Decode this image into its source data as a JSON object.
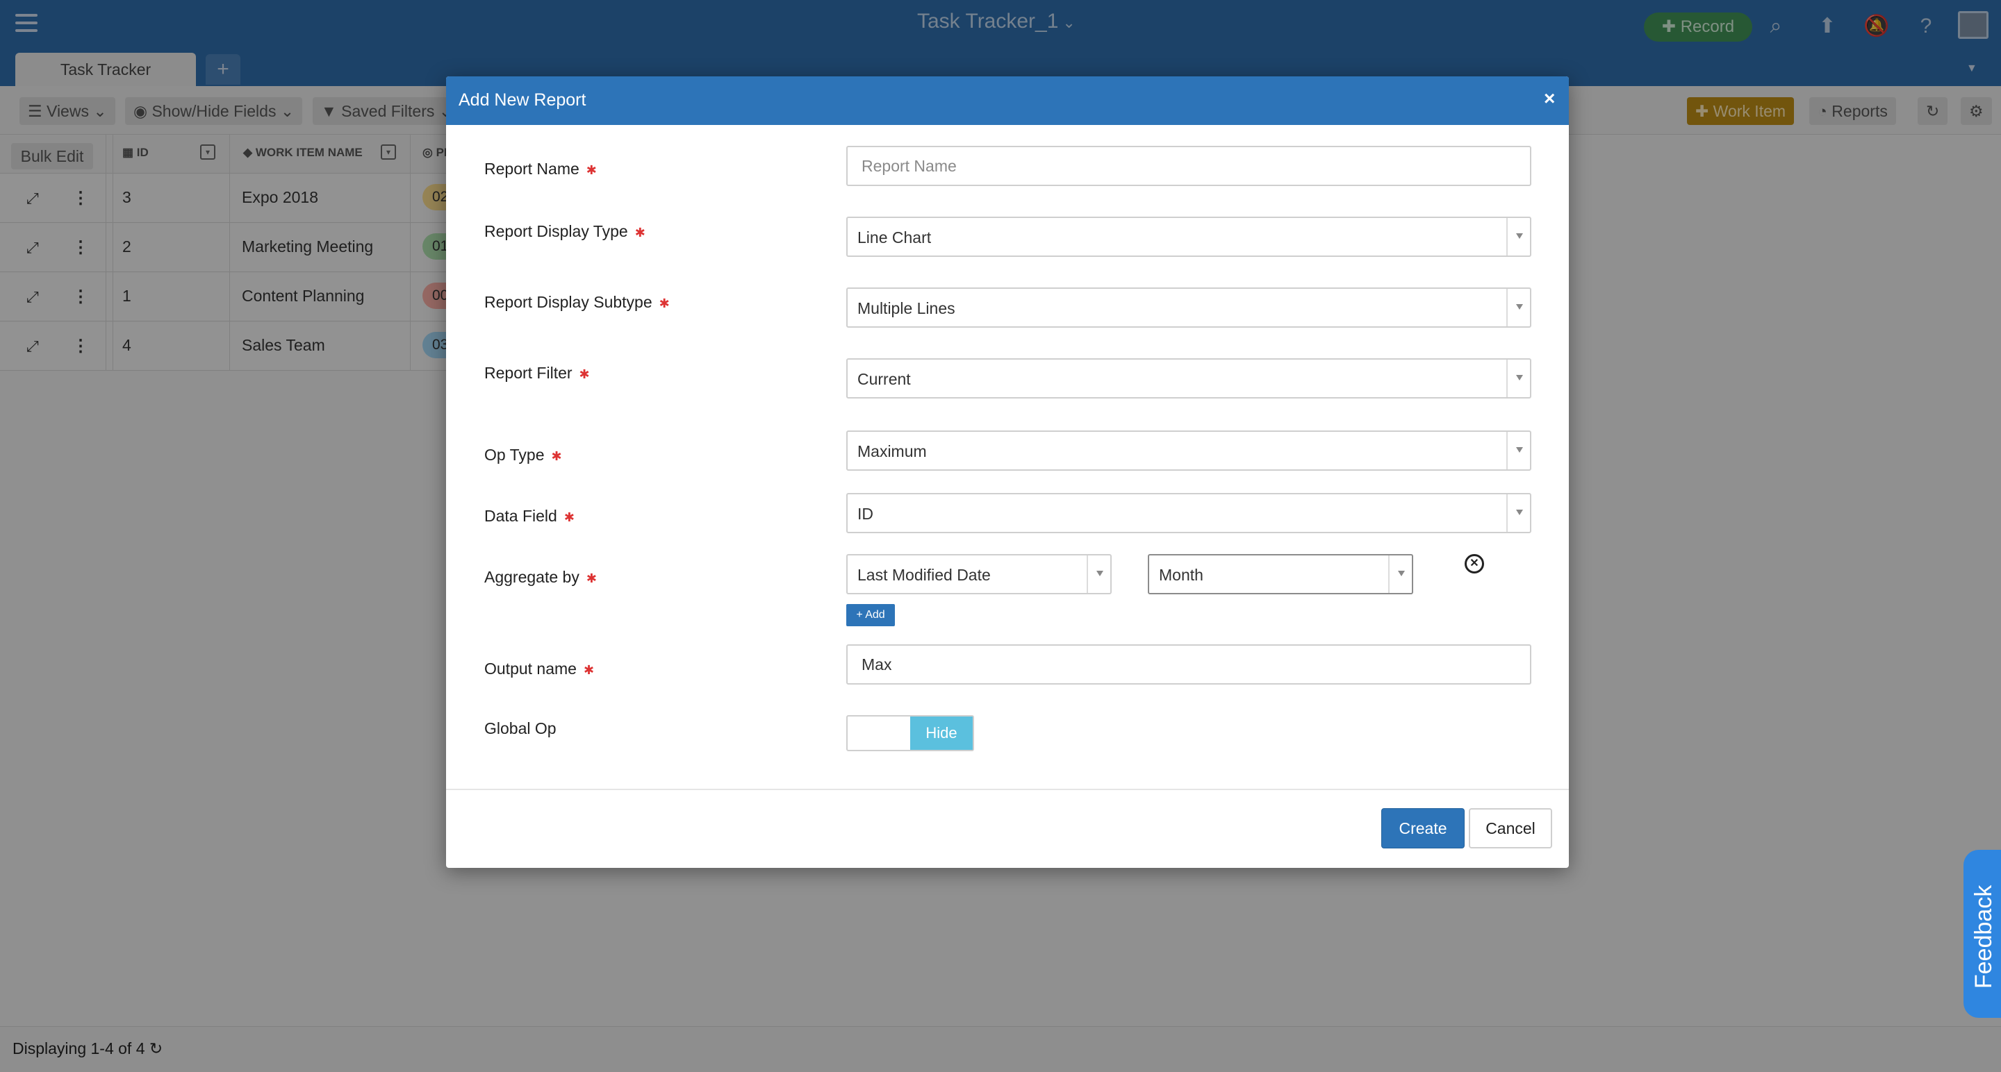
{
  "app": {
    "title": "Task Tracker_1",
    "title_icon": "chevron-down-icon"
  },
  "topbar": {
    "record_label": "Record",
    "icons": [
      "search-icon",
      "upload-icon",
      "bell-off-icon",
      "help-icon",
      "user-avatar"
    ]
  },
  "tabs": [
    {
      "label": "Task Tracker"
    }
  ],
  "tab_add": "+",
  "toolbar": {
    "views": "Views",
    "show_hide": "Show/Hide Fields",
    "saved_filters": "Saved Filters",
    "work_item": "Work Item",
    "reports": "Reports"
  },
  "grid": {
    "bulk_edit": "Bulk Edit",
    "columns": {
      "id": "ID",
      "name": "WORK ITEM NAME",
      "p": "PI"
    },
    "rows": [
      {
        "id": "3",
        "name": "Expo 2018",
        "badge": "02",
        "badge_color": "#f3d58a"
      },
      {
        "id": "2",
        "name": "Marketing Meeting",
        "badge": "01",
        "badge_color": "#a8d8a8"
      },
      {
        "id": "1",
        "name": "Content Planning",
        "badge": "00",
        "badge_color": "#f0a8a0"
      },
      {
        "id": "4",
        "name": "Sales Team",
        "badge": "03",
        "badge_color": "#9fd0ee"
      }
    ]
  },
  "footer": {
    "status": "Displaying 1-4 of 4"
  },
  "feedback": "Feedback",
  "modal": {
    "title": "Add New Report",
    "close": "×",
    "fields": {
      "report_name": {
        "label": "Report Name",
        "placeholder": "Report Name",
        "value": ""
      },
      "display_type": {
        "label": "Report Display Type",
        "value": "Line Chart"
      },
      "display_subtype": {
        "label": "Report Display Subtype",
        "value": "Multiple Lines"
      },
      "report_filter": {
        "label": "Report Filter",
        "value": "Current"
      },
      "op_type": {
        "label": "Op Type",
        "value": "Maximum"
      },
      "data_field": {
        "label": "Data Field",
        "value": "ID"
      },
      "aggregate_by": {
        "label": "Aggregate by",
        "field": "Last Modified Date",
        "period": "Month",
        "add_label": "+ Add"
      },
      "output_name": {
        "label": "Output name",
        "value": "Max"
      },
      "global_op": {
        "label": "Global Op",
        "toggle_label": "Hide"
      }
    },
    "buttons": {
      "create": "Create",
      "cancel": "Cancel"
    }
  }
}
